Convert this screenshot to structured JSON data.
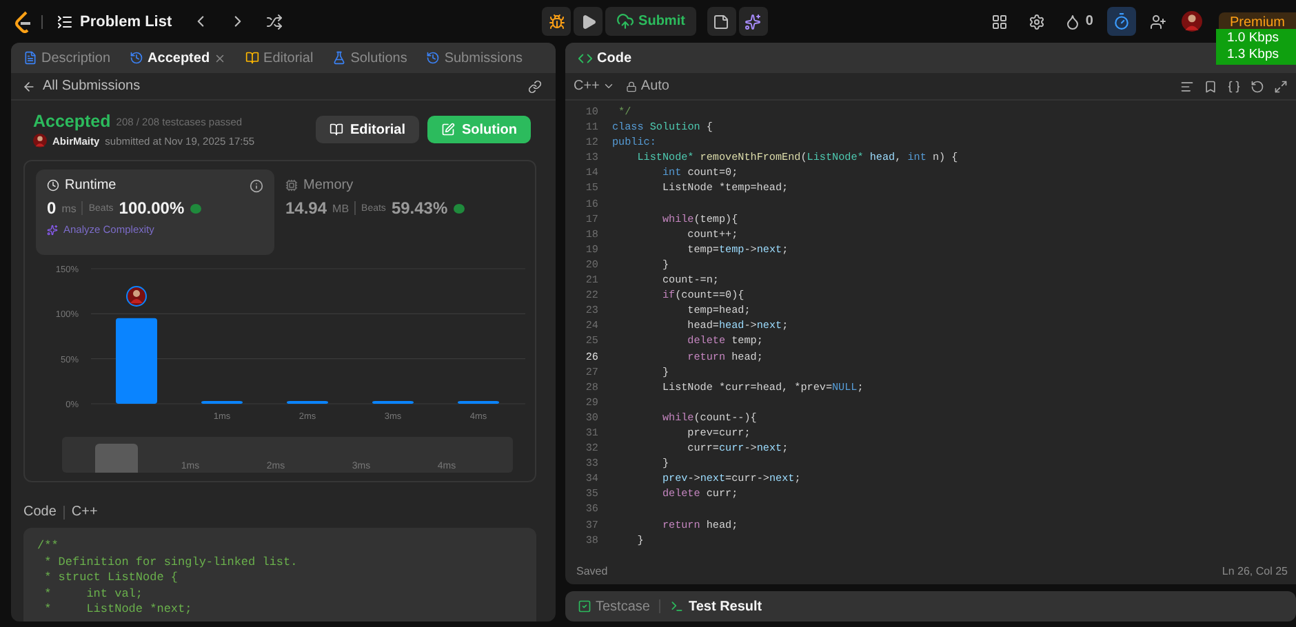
{
  "top_bar": {
    "title": "Problem List",
    "submit": "Submit",
    "streak": "0",
    "premium": "Premium"
  },
  "network_overlay": [
    "1.0 Kbps",
    "1.3 Kbps"
  ],
  "left_panel": {
    "tabs": [
      {
        "label": "Description",
        "selected": false,
        "kind": "description"
      },
      {
        "label": "Accepted",
        "selected": true,
        "kind": "accepted"
      },
      {
        "label": "Editorial",
        "selected": false,
        "kind": "editorial"
      },
      {
        "label": "Solutions",
        "selected": false,
        "kind": "solutions"
      },
      {
        "label": "Submissions",
        "selected": false,
        "kind": "submissions"
      }
    ],
    "back_link": "All Submissions",
    "result": {
      "status": "Accepted",
      "testcases": "208 / 208 testcases passed",
      "user": "AbirMaity",
      "submitted": "submitted at Nov 19, 2025 17:55"
    },
    "buttons": [
      "Editorial",
      "Solution"
    ],
    "runtime": {
      "title": "Runtime",
      "value": "0",
      "unit": "ms",
      "beats_label": "Beats",
      "beats": "100.00%",
      "analyze": "Analyze Complexity",
      "selected": true
    },
    "memory": {
      "title": "Memory",
      "value": "14.94",
      "unit": "MB",
      "beats_label": "Beats",
      "beats": "59.43%",
      "selected": false
    },
    "chart_data": {
      "type": "bar",
      "categories": [
        null,
        "1ms",
        "2ms",
        "3ms",
        "4ms"
      ],
      "series": [
        {
          "color": "#0a84ff",
          "values": [
            95,
            3,
            3,
            3,
            3
          ]
        }
      ],
      "ylim": [
        0,
        150
      ],
      "yticks": [
        {
          "value": 0,
          "label": "0%"
        },
        {
          "value": 50,
          "label": "50%"
        },
        {
          "value": 100,
          "label": "100%"
        },
        {
          "value": 150,
          "label": "150%"
        }
      ]
    },
    "navigator_labels": [
      "1ms",
      "2ms",
      "3ms",
      "4ms"
    ],
    "code_header": {
      "label": "Code",
      "language": "C++"
    },
    "code": [
      "/**",
      " * Definition for singly-linked list.",
      " * struct ListNode {",
      " *     int val;",
      " *     ListNode *next;"
    ]
  },
  "editor": {
    "title": "Code",
    "language": "C++",
    "mode": "Auto",
    "status": "Saved",
    "cursor": "Ln 26, Col 25",
    "lines": [
      {
        "n": "10",
        "current": false,
        "segs": [
          {
            "t": " */",
            "kind": "cmt"
          }
        ]
      },
      {
        "n": "11",
        "current": false,
        "segs": [
          {
            "t": "class",
            "kind": "key"
          },
          {
            "t": " Solution",
            "kind": "type"
          },
          {
            "t": " {",
            "kind": "plain"
          }
        ]
      },
      {
        "n": "12",
        "current": false,
        "segs": [
          {
            "t": "public:",
            "kind": "key"
          }
        ]
      },
      {
        "n": "13",
        "current": false,
        "segs": [
          {
            "t": "    ListNode*",
            "kind": "type"
          },
          {
            "t": " removeNthFromEnd",
            "kind": "fn"
          },
          {
            "t": "(",
            "kind": "plain"
          },
          {
            "t": "ListNode*",
            "kind": "type"
          },
          {
            "t": " head",
            "kind": "var"
          },
          {
            "t": ", ",
            "kind": "plain"
          },
          {
            "t": "int",
            "kind": "key"
          },
          {
            "t": " n) {",
            "kind": "plain"
          }
        ]
      },
      {
        "n": "14",
        "current": false,
        "segs": [
          {
            "t": "        int",
            "kind": "key"
          },
          {
            "t": " count=0;",
            "kind": "plain"
          }
        ]
      },
      {
        "n": "15",
        "current": false,
        "segs": [
          {
            "t": "        ListNode *temp=head;",
            "kind": "plain"
          }
        ]
      },
      {
        "n": "16",
        "current": false
      },
      {
        "n": "17",
        "current": false,
        "segs": [
          {
            "t": "        while",
            "kind": "kw"
          },
          {
            "t": "(temp){",
            "kind": "plain"
          }
        ]
      },
      {
        "n": "18",
        "current": false,
        "segs": [
          {
            "t": "            count++;",
            "kind": "plain"
          }
        ]
      },
      {
        "n": "19",
        "current": false,
        "segs": [
          {
            "t": "            temp=",
            "kind": "plain"
          },
          {
            "t": "temp",
            "kind": "var"
          },
          {
            "t": "->",
            "kind": "plain"
          },
          {
            "t": "next",
            "kind": "var"
          },
          {
            "t": ";",
            "kind": "plain"
          }
        ]
      },
      {
        "n": "20",
        "current": false,
        "segs": [
          {
            "t": "        }",
            "kind": "plain"
          }
        ]
      },
      {
        "n": "21",
        "current": false,
        "segs": [
          {
            "t": "        count-=n;",
            "kind": "plain"
          }
        ]
      },
      {
        "n": "22",
        "current": false,
        "segs": [
          {
            "t": "        if",
            "kind": "kw"
          },
          {
            "t": "(count==0){",
            "kind": "plain"
          }
        ]
      },
      {
        "n": "23",
        "current": false,
        "segs": [
          {
            "t": "            temp=head;",
            "kind": "plain"
          }
        ]
      },
      {
        "n": "24",
        "current": false,
        "segs": [
          {
            "t": "            head=",
            "kind": "plain"
          },
          {
            "t": "head",
            "kind": "var"
          },
          {
            "t": "->",
            "kind": "plain"
          },
          {
            "t": "next",
            "kind": "var"
          },
          {
            "t": ";",
            "kind": "plain"
          }
        ]
      },
      {
        "n": "25",
        "current": false,
        "segs": [
          {
            "t": "            delete",
            "kind": "kw"
          },
          {
            "t": " temp;",
            "kind": "plain"
          }
        ]
      },
      {
        "n": "26",
        "current": true,
        "segs": [
          {
            "t": "            return",
            "kind": "kw"
          },
          {
            "t": " head;",
            "kind": "plain"
          }
        ]
      },
      {
        "n": "27",
        "current": false,
        "segs": [
          {
            "t": "        }",
            "kind": "plain"
          }
        ]
      },
      {
        "n": "28",
        "current": false,
        "segs": [
          {
            "t": "        ListNode *curr=head, *prev=",
            "kind": "plain"
          },
          {
            "t": "NULL",
            "kind": "key"
          },
          {
            "t": ";",
            "kind": "plain"
          }
        ]
      },
      {
        "n": "29",
        "current": false
      },
      {
        "n": "30",
        "current": false,
        "segs": [
          {
            "t": "        while",
            "kind": "kw"
          },
          {
            "t": "(count--){",
            "kind": "plain"
          }
        ]
      },
      {
        "n": "31",
        "current": false,
        "segs": [
          {
            "t": "            prev=curr;",
            "kind": "plain"
          }
        ]
      },
      {
        "n": "32",
        "current": false,
        "segs": [
          {
            "t": "            curr=",
            "kind": "plain"
          },
          {
            "t": "curr",
            "kind": "var"
          },
          {
            "t": "->",
            "kind": "plain"
          },
          {
            "t": "next",
            "kind": "var"
          },
          {
            "t": ";",
            "kind": "plain"
          }
        ]
      },
      {
        "n": "33",
        "current": false,
        "segs": [
          {
            "t": "        }",
            "kind": "plain"
          }
        ]
      },
      {
        "n": "34",
        "current": false,
        "segs": [
          {
            "t": "        prev",
            "kind": "var"
          },
          {
            "t": "->",
            "kind": "plain"
          },
          {
            "t": "next",
            "kind": "var"
          },
          {
            "t": "=curr->",
            "kind": "plain"
          },
          {
            "t": "next",
            "kind": "var"
          },
          {
            "t": ";",
            "kind": "plain"
          }
        ]
      },
      {
        "n": "35",
        "current": false,
        "segs": [
          {
            "t": "        delete",
            "kind": "kw"
          },
          {
            "t": " curr;",
            "kind": "plain"
          }
        ]
      },
      {
        "n": "36",
        "current": false
      },
      {
        "n": "37",
        "current": false,
        "segs": [
          {
            "t": "        return",
            "kind": "kw"
          },
          {
            "t": " head;",
            "kind": "plain"
          }
        ]
      },
      {
        "n": "38",
        "current": false,
        "segs": [
          {
            "t": "    }",
            "kind": "plain"
          }
        ]
      }
    ]
  },
  "bottom_tabs": [
    {
      "label": "Testcase",
      "selected": false
    },
    {
      "label": "Test Result",
      "selected": true
    }
  ]
}
